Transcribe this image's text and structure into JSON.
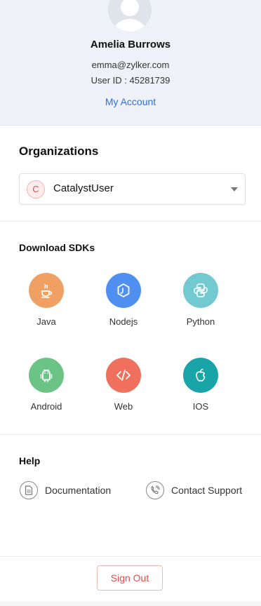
{
  "profile": {
    "name": "Amelia Burrows",
    "email": "emma@zylker.com",
    "user_id": "User ID : 45281739",
    "my_account_link": "My Account"
  },
  "organizations": {
    "title": "Organizations",
    "selected": {
      "badge": "C",
      "name": "CatalystUser"
    }
  },
  "sdks": {
    "title": "Download SDKs",
    "items": [
      {
        "label": "Java",
        "icon": "java-icon",
        "color": "#f0a062"
      },
      {
        "label": "Nodejs",
        "icon": "nodejs-icon",
        "color": "#4f8ff0"
      },
      {
        "label": "Python",
        "icon": "python-icon",
        "color": "#72c9d0"
      },
      {
        "label": "Android",
        "icon": "android-icon",
        "color": "#6cc386"
      },
      {
        "label": "Web",
        "icon": "web-code-icon",
        "color": "#f0705e"
      },
      {
        "label": "IOS",
        "icon": "apple-icon",
        "color": "#19a5a8"
      }
    ]
  },
  "help": {
    "title": "Help",
    "documentation": "Documentation",
    "contact_support": "Contact Support"
  },
  "footer": {
    "sign_out": "Sign Out"
  }
}
